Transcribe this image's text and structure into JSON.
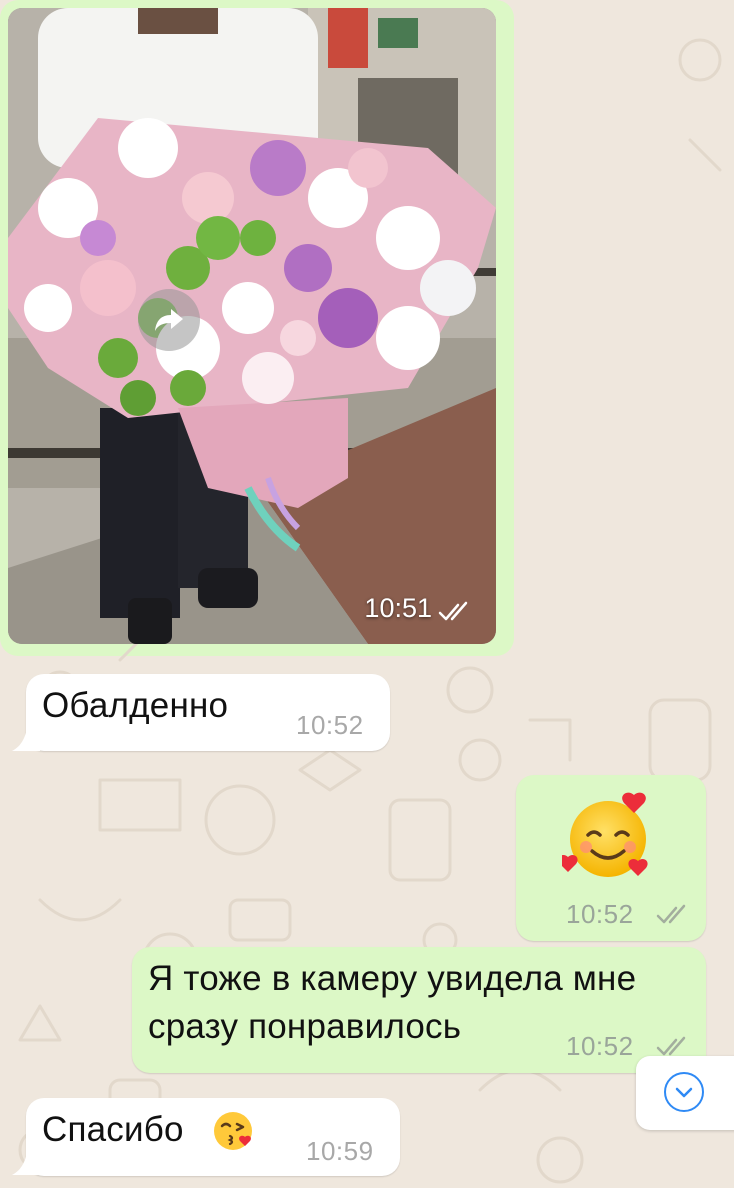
{
  "chat": {
    "photo_message": {
      "time": "10:51",
      "status": "read",
      "accent": "#dcf8c6"
    },
    "messages": [
      {
        "direction": "incoming",
        "text": "Обалденно",
        "time": "10:52"
      },
      {
        "direction": "outgoing",
        "emoji": "smiling-face-with-hearts",
        "time": "10:52",
        "status": "read"
      },
      {
        "direction": "outgoing",
        "line1": "Я тоже в камеру увидела мне",
        "line2": "сразу понравилось",
        "time": "10:52",
        "status": "read"
      },
      {
        "direction": "incoming",
        "text": "Спасибо",
        "emoji": "face-blowing-a-kiss",
        "time": "10:59"
      }
    ]
  },
  "icons": {
    "forward": "forward-arrow-icon",
    "scroll": "chevron-down-icon",
    "read_ticks": "double-check-icon"
  },
  "colors": {
    "background": "#efe7dd",
    "incoming_bubble": "#ffffff",
    "outgoing_bubble": "#dcf8c6",
    "accent_blue": "#2f8af5"
  }
}
